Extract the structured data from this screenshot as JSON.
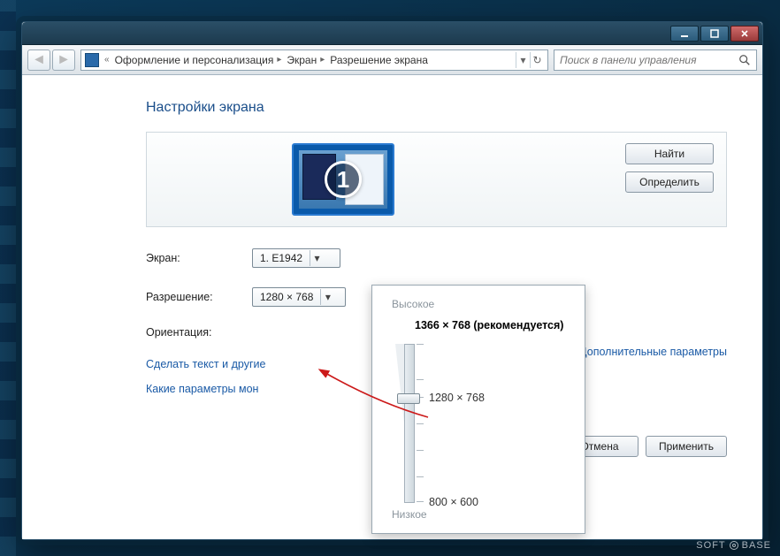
{
  "breadcrumb": {
    "seg1": "Оформление и персонализация",
    "seg2": "Экран",
    "seg3": "Разрешение экрана"
  },
  "search": {
    "placeholder": "Поиск в панели управления"
  },
  "page": {
    "title": "Настройки экрана"
  },
  "buttons": {
    "find": "Найти",
    "detect": "Определить",
    "cancel": "Отмена",
    "apply": "Применить"
  },
  "monitor": {
    "number": "1"
  },
  "labels": {
    "screen": "Экран:",
    "resolution": "Разрешение:",
    "orientation": "Ориентация:"
  },
  "screen_dd": {
    "value": "1. E1942"
  },
  "res_dd": {
    "value": "1280 × 768"
  },
  "links": {
    "advanced": "Дополнительные параметры",
    "textsize": "Сделать текст и другие",
    "which": "Какие параметры мон"
  },
  "slider": {
    "high": "Высокое",
    "low": "Низкое",
    "recommended": "1366 × 768 (рекомендуется)",
    "current": "1280 × 768",
    "bottom": "800 × 600"
  },
  "watermark": {
    "a": "SOFT",
    "b": "BASE"
  }
}
